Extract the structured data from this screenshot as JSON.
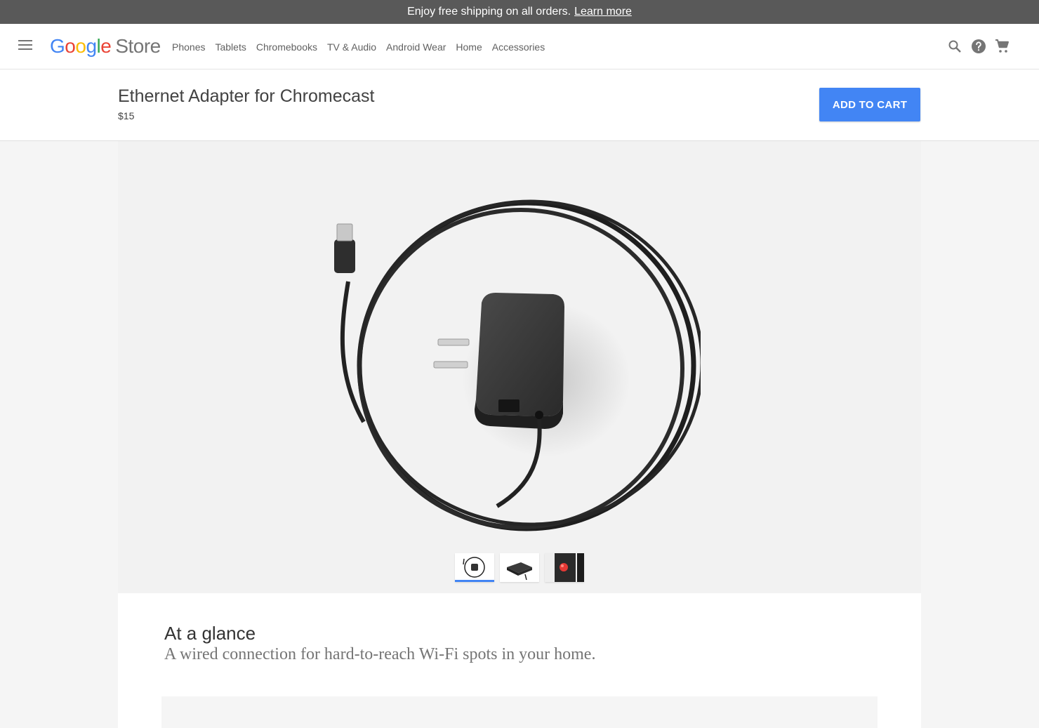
{
  "promo": {
    "text": "Enjoy free shipping on all orders.",
    "link": "Learn more"
  },
  "header": {
    "logo_letters": [
      "G",
      "o",
      "o",
      "g",
      "l",
      "e"
    ],
    "logo_store": "Store",
    "nav": [
      "Phones",
      "Tablets",
      "Chromebooks",
      "TV & Audio",
      "Android Wear",
      "Home",
      "Accessories"
    ],
    "icons": [
      "search-icon",
      "help-icon",
      "cart-icon"
    ]
  },
  "product": {
    "title": "Ethernet Adapter for Chromecast",
    "price": "$15",
    "add_to_cart": "ADD TO CART"
  },
  "gallery": {
    "thumbnails": [
      "adapter-with-cable",
      "adapter-side",
      "adapter-red-detail"
    ],
    "selected_index": 0
  },
  "glance": {
    "title": "At a glance",
    "subtitle": "A wired connection for hard-to-reach Wi-Fi spots in your home."
  },
  "colors": {
    "accent": "#4285f4",
    "promo_bg": "#595959"
  }
}
